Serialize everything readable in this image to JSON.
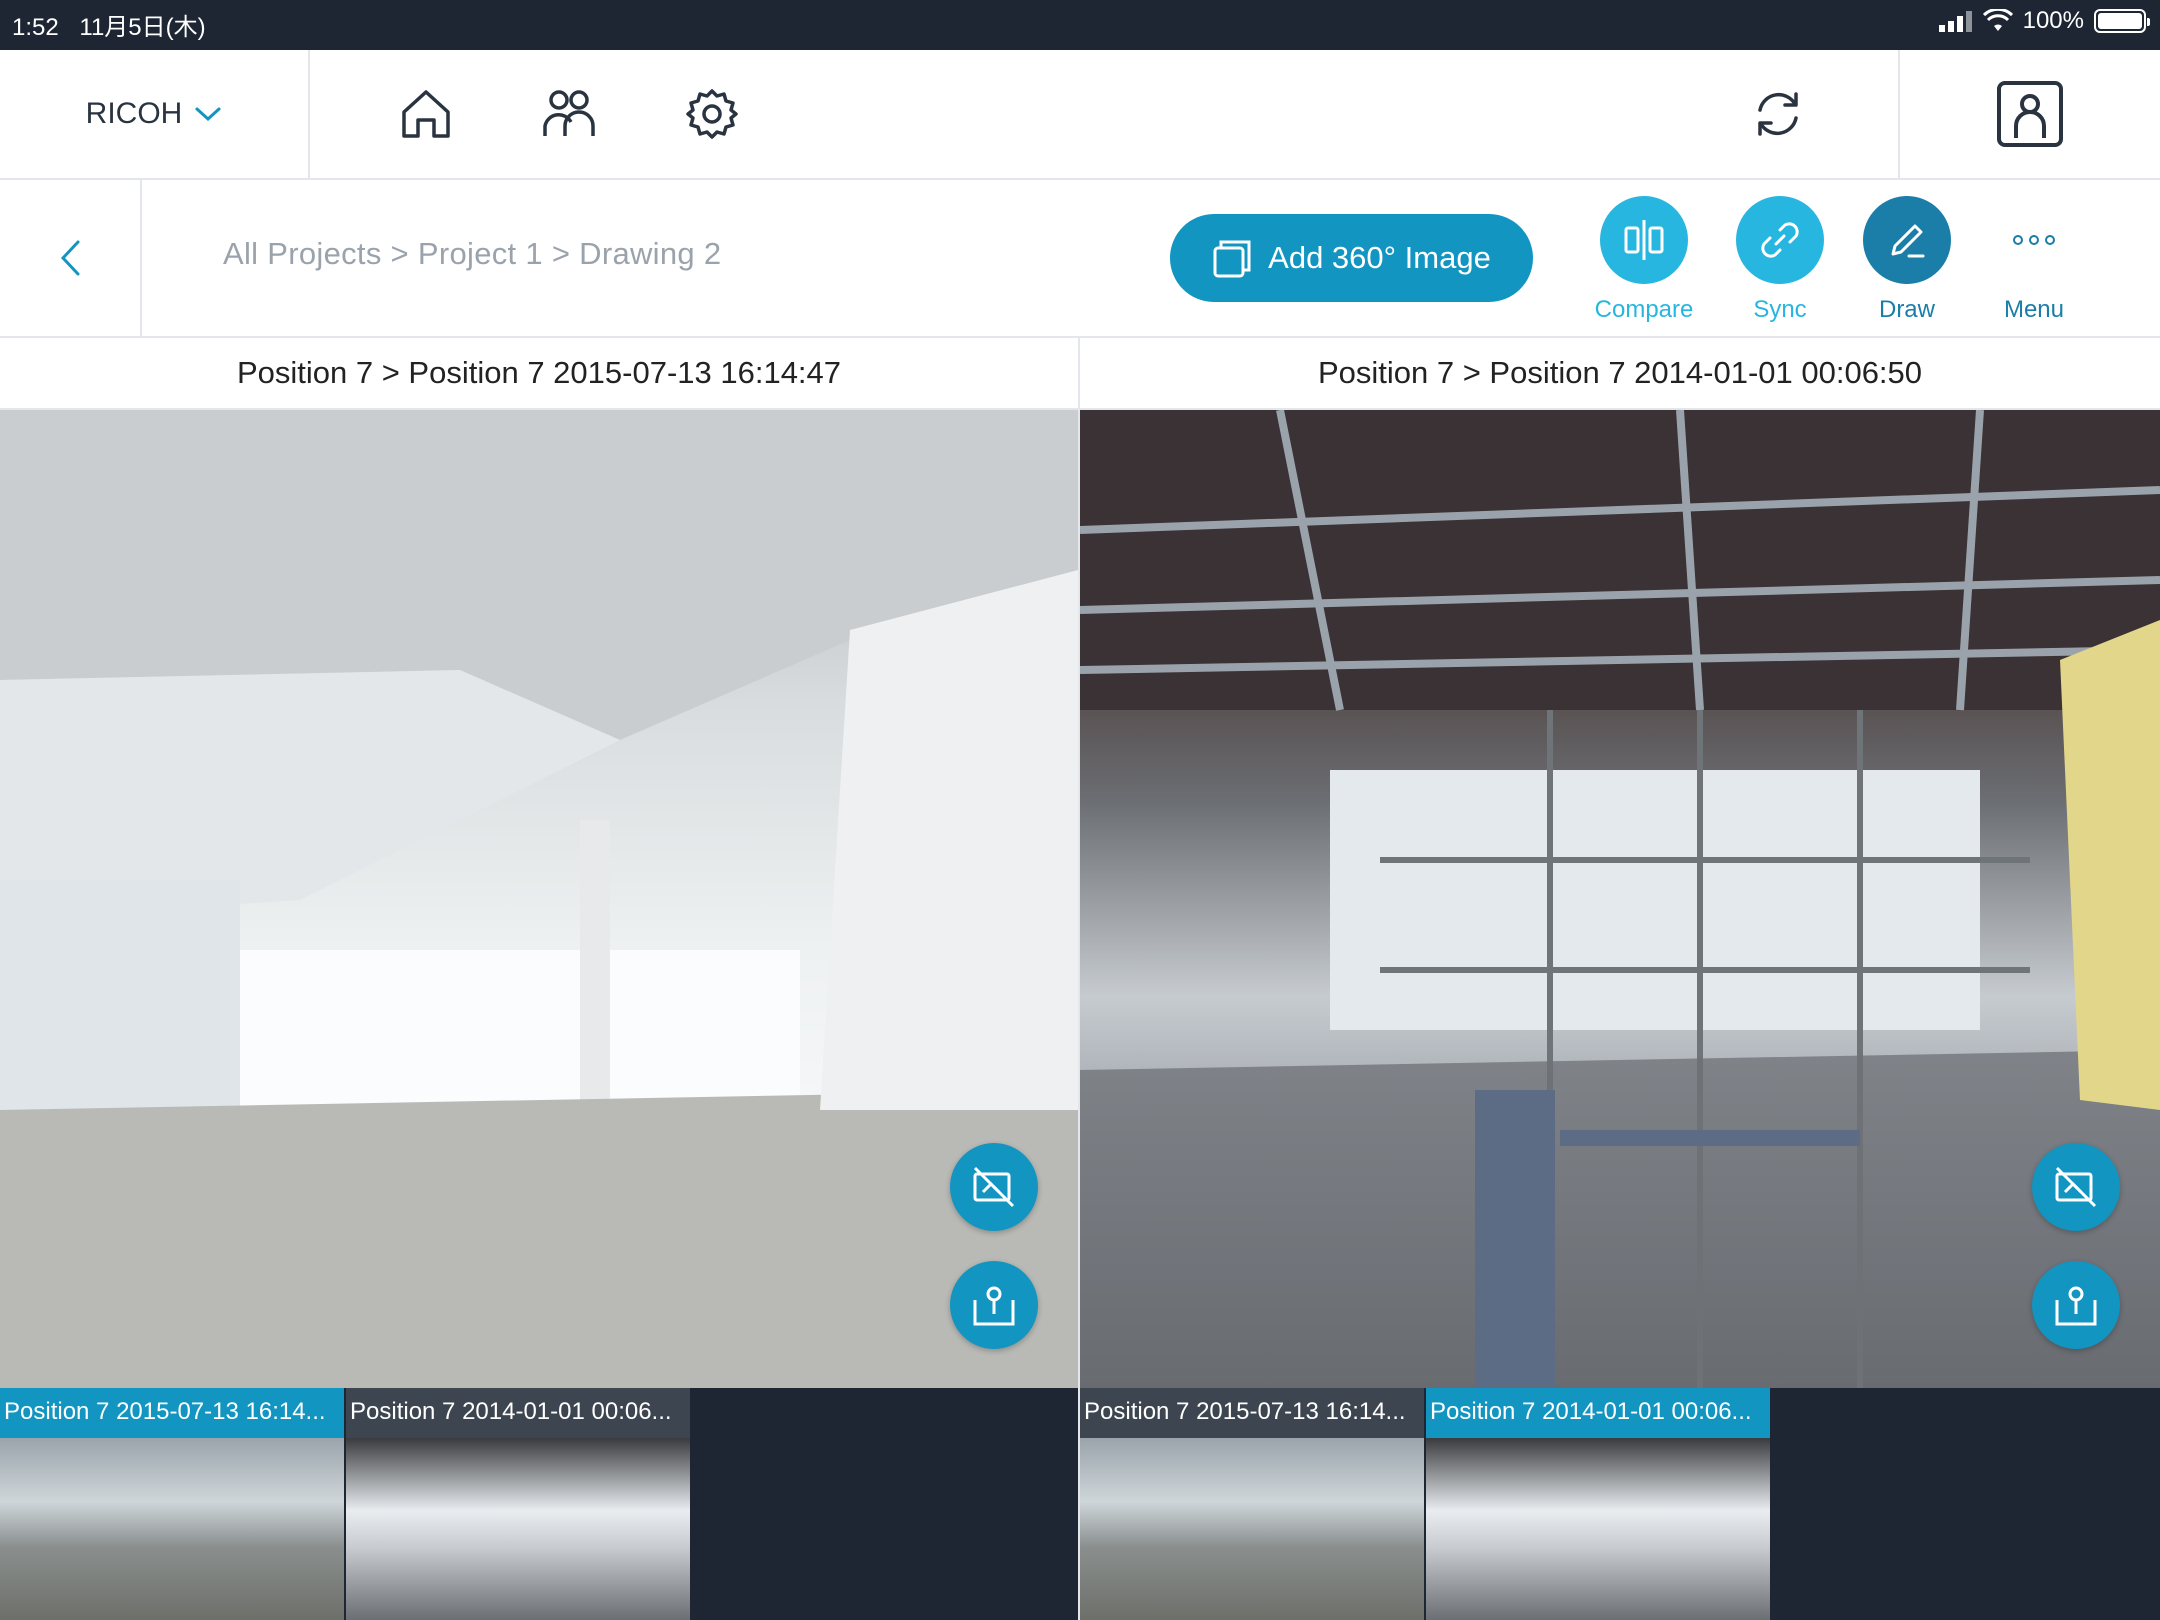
{
  "status_bar": {
    "time": "1:52",
    "date": "11月5日(木)",
    "battery": "100%"
  },
  "nav": {
    "brand": "RICOH"
  },
  "toolbar": {
    "breadcrumb": "All Projects > Project 1 > Drawing 2",
    "add_label": "Add 360° Image",
    "compare_label": "Compare",
    "sync_label": "Sync",
    "draw_label": "Draw",
    "menu_label": "Menu"
  },
  "panels": {
    "left_title": "Position 7 > Position 7 2015-07-13 16:14:47",
    "right_title": "Position 7 > Position 7 2014-01-01 00:06:50"
  },
  "thumbs_left": [
    {
      "label": "Position 7 2015-07-13 16:14...",
      "selected": true
    },
    {
      "label": "Position 7 2014-01-01 00:06...",
      "selected": false
    }
  ],
  "thumbs_right": [
    {
      "label": "Position 7 2015-07-13 16:14...",
      "selected": false
    },
    {
      "label": "Position 7 2014-01-01 00:06...",
      "selected": true
    }
  ],
  "colors": {
    "accent": "#1295c1",
    "light_accent": "#27b6e0",
    "dark": "#1d2632",
    "draw": "#1a7ea8"
  }
}
